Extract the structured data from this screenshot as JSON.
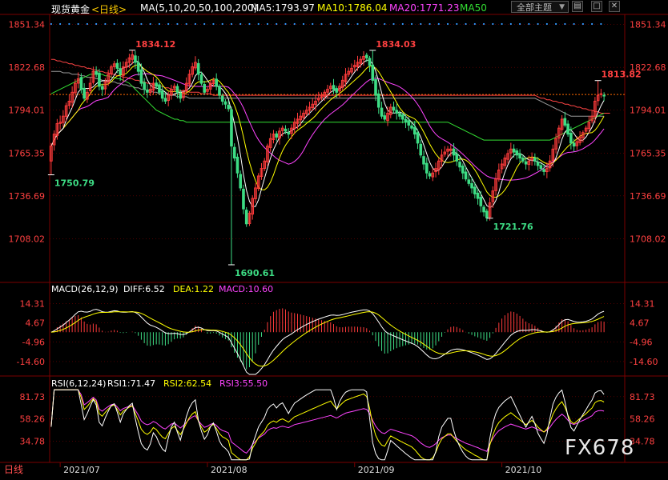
{
  "toolbar": {
    "symbol": "现货黄金",
    "period": "<日线>",
    "ma_params": "MA(5,10,20,50,100,200)",
    "ma5": "MA5:1793.97",
    "ma10": "MA10:1786.04",
    "ma20": "MA20:1771.23",
    "ma50": "MA50",
    "theme_button": "全部主题",
    "icons": [
      "dropdown-arrow-icon",
      "panel-toggle-icon",
      "maximize-icon",
      "close-icon"
    ]
  },
  "colors": {
    "up": "#ff3b3b",
    "down": "#3ddc84",
    "ma5": "#ffffff",
    "ma10": "#ffff00",
    "ma20": "#ff44ff",
    "ma50": "#33dd33",
    "ma100": "#999999",
    "ma200": "#ff4444",
    "axis_text": "#ff4040",
    "grid": "#7a0000"
  },
  "macd_panel": {
    "title": "MACD(26,12,9)",
    "diff": "DIFF:6.52",
    "dea": "DEA:1.22",
    "macd": "MACD:10.60"
  },
  "rsi_panel": {
    "title": "RSI(6,12,24)",
    "rsi1": "RSI1:71.47",
    "rsi2": "RSI2:62.54",
    "rsi3": "RSI3:55.50"
  },
  "watermark": "FX678",
  "period_tag": "日线",
  "chart_data": {
    "type": "candlestick",
    "y_ticks": [
      "1851.34",
      "1822.68",
      "1794.01",
      "1765.35",
      "1736.69",
      "1708.02"
    ],
    "y_tick_values": [
      1851.34,
      1822.68,
      1794.01,
      1765.35,
      1736.69,
      1708.02
    ],
    "ylim": [
      1679.36,
      1857
    ],
    "macd_ticks": [
      "14.31",
      "4.67",
      "-4.96",
      "-14.60"
    ],
    "macd_tick_values": [
      14.31,
      4.67,
      -4.96,
      -14.6
    ],
    "macd_ylim": [
      -21,
      18
    ],
    "rsi_ticks": [
      "81.73",
      "58.26",
      "34.78"
    ],
    "rsi_tick_values": [
      81.73,
      58.26,
      34.78
    ],
    "rsi_ylim": [
      14,
      90
    ],
    "x_labels": [
      "2021/07",
      "2021/08",
      "2021/09",
      "2021/10"
    ],
    "x_label_index": [
      3,
      52,
      101,
      150
    ],
    "current_price": 1804.5,
    "annotations": [
      {
        "text": "1834.12",
        "index": 27,
        "price": 1834.12,
        "kind": "high"
      },
      {
        "text": "1750.79",
        "index": 0,
        "price": 1750.79,
        "kind": "low"
      },
      {
        "text": "1690.61",
        "index": 60,
        "price": 1690.61,
        "kind": "low"
      },
      {
        "text": "1834.03",
        "index": 107,
        "price": 1834.03,
        "kind": "high"
      },
      {
        "text": "1721.76",
        "index": 146,
        "price": 1721.76,
        "kind": "low"
      },
      {
        "text": "1813.82",
        "index": 182,
        "price": 1813.82,
        "kind": "high"
      }
    ],
    "close": [
      1770,
      1778,
      1785,
      1786,
      1790,
      1797,
      1800,
      1806,
      1812,
      1815,
      1808,
      1802,
      1806,
      1812,
      1820,
      1818,
      1810,
      1808,
      1813,
      1818,
      1823,
      1825,
      1822,
      1818,
      1823,
      1826,
      1829,
      1831,
      1826,
      1820,
      1812,
      1808,
      1806,
      1808,
      1812,
      1810,
      1806,
      1802,
      1800,
      1804,
      1808,
      1810,
      1806,
      1802,
      1806,
      1812,
      1818,
      1823,
      1826,
      1818,
      1812,
      1806,
      1808,
      1812,
      1814,
      1810,
      1804,
      1800,
      1798,
      1795,
      1770,
      1762,
      1752,
      1742,
      1728,
      1718,
      1725,
      1735,
      1742,
      1750,
      1755,
      1760,
      1770,
      1775,
      1778,
      1776,
      1780,
      1782,
      1780,
      1778,
      1782,
      1786,
      1788,
      1790,
      1792,
      1794,
      1796,
      1798,
      1800,
      1802,
      1804,
      1806,
      1808,
      1810,
      1808,
      1806,
      1810,
      1814,
      1818,
      1820,
      1822,
      1824,
      1826,
      1828,
      1830,
      1829,
      1824,
      1814,
      1804,
      1796,
      1790,
      1788,
      1792,
      1796,
      1794,
      1792,
      1790,
      1788,
      1786,
      1784,
      1782,
      1778,
      1772,
      1764,
      1758,
      1752,
      1750,
      1752,
      1755,
      1760,
      1764,
      1766,
      1768,
      1768,
      1764,
      1760,
      1756,
      1752,
      1748,
      1745,
      1742,
      1738,
      1735,
      1730,
      1726,
      1722,
      1732,
      1740,
      1748,
      1754,
      1758,
      1762,
      1765,
      1768,
      1766,
      1764,
      1762,
      1760,
      1758,
      1760,
      1762,
      1760,
      1757,
      1755,
      1753,
      1755,
      1760,
      1768,
      1775,
      1782,
      1788,
      1784,
      1778,
      1772,
      1770,
      1773,
      1776,
      1779,
      1782,
      1786,
      1790,
      1800,
      1804,
      1805,
      1804
    ],
    "ma50": [
      1805,
      1806,
      1807,
      1808,
      1809,
      1810,
      1811,
      1812,
      1813,
      1814,
      1815,
      1816,
      1817,
      1818,
      1818,
      1818,
      1818,
      1818,
      1817,
      1817,
      1816,
      1816,
      1815,
      1815,
      1814,
      1813,
      1812,
      1810,
      1808,
      1806,
      1804,
      1802,
      1800,
      1798,
      1796,
      1794,
      1793,
      1792,
      1791,
      1790,
      1789,
      1788,
      1788,
      1787,
      1787,
      1786,
      1786,
      1786,
      1786,
      1786,
      1786,
      1786,
      1786,
      1786,
      1786,
      1786,
      1786,
      1786,
      1786,
      1786,
      1786,
      1786,
      1786,
      1786,
      1786,
      1786,
      1786,
      1786,
      1786,
      1786,
      1786,
      1786,
      1786,
      1786,
      1786,
      1786,
      1786,
      1786,
      1786,
      1786,
      1786,
      1786,
      1786,
      1786,
      1786,
      1786,
      1786,
      1786,
      1786,
      1786,
      1786,
      1786,
      1786,
      1786,
      1786,
      1786,
      1786,
      1786,
      1786,
      1786,
      1786,
      1786,
      1786,
      1786,
      1786,
      1786,
      1786,
      1786,
      1786,
      1786,
      1786,
      1786,
      1786,
      1786,
      1786,
      1786,
      1786,
      1786,
      1786,
      1786,
      1786,
      1786,
      1786,
      1786,
      1786,
      1786,
      1786,
      1786,
      1786,
      1786,
      1786,
      1786,
      1786,
      1785,
      1784,
      1783,
      1782,
      1781,
      1780,
      1779,
      1778,
      1777,
      1776,
      1775,
      1774,
      1774,
      1774,
      1774,
      1774,
      1774,
      1774,
      1774,
      1774,
      1774,
      1774,
      1774,
      1774,
      1774,
      1774,
      1774,
      1774,
      1774,
      1774,
      1774,
      1774,
      1774,
      1774,
      1775,
      1776,
      1777,
      1778,
      1779,
      1780,
      1781,
      1782,
      1783,
      1784,
      1785,
      1786,
      1787,
      1788,
      1789,
      1790,
      1791,
      1792
    ],
    "ma100": [
      1820,
      1820,
      1820,
      1820,
      1819,
      1819,
      1819,
      1818,
      1818,
      1818,
      1817,
      1817,
      1816,
      1816,
      1816,
      1815,
      1815,
      1814,
      1814,
      1814,
      1813,
      1813,
      1812,
      1812,
      1811,
      1811,
      1810,
      1810,
      1809,
      1809,
      1808,
      1808,
      1807,
      1807,
      1806,
      1806,
      1805,
      1805,
      1805,
      1804,
      1804,
      1804,
      1803,
      1803,
      1803,
      1803,
      1802,
      1802,
      1802,
      1802,
      1802,
      1802,
      1802,
      1802,
      1802,
      1802,
      1802,
      1802,
      1802,
      1802,
      1802,
      1802,
      1802,
      1802,
      1802,
      1802,
      1802,
      1802,
      1802,
      1802,
      1802,
      1802,
      1802,
      1802,
      1802,
      1802,
      1802,
      1802,
      1802,
      1802,
      1802,
      1802,
      1802,
      1802,
      1802,
      1802,
      1802,
      1802,
      1802,
      1802,
      1802,
      1802,
      1802,
      1802,
      1802,
      1802,
      1802,
      1802,
      1802,
      1802,
      1802,
      1802,
      1802,
      1802,
      1802,
      1802,
      1802,
      1802,
      1802,
      1802,
      1802,
      1802,
      1802,
      1802,
      1802,
      1802,
      1802,
      1802,
      1802,
      1802,
      1802,
      1802,
      1802,
      1802,
      1802,
      1802,
      1802,
      1802,
      1802,
      1802,
      1802,
      1802,
      1802,
      1802,
      1802,
      1802,
      1802,
      1802,
      1802,
      1802,
      1802,
      1802,
      1802,
      1802,
      1802,
      1802,
      1802,
      1802,
      1802,
      1802,
      1802,
      1802,
      1802,
      1802,
      1802,
      1802,
      1802,
      1802,
      1802,
      1802,
      1802,
      1802,
      1801,
      1800,
      1799,
      1798,
      1797,
      1796,
      1795,
      1794,
      1793,
      1792,
      1791,
      1790,
      1790,
      1790,
      1790,
      1790,
      1790,
      1790,
      1790,
      1790,
      1790,
      1790,
      1790
    ],
    "ma200": [
      1828,
      1828,
      1827,
      1827,
      1826,
      1826,
      1825,
      1825,
      1824,
      1824,
      1823,
      1823,
      1822,
      1822,
      1821,
      1821,
      1820,
      1820,
      1819,
      1819,
      1818,
      1818,
      1817,
      1817,
      1816,
      1816,
      1815,
      1815,
      1814,
      1814,
      1813,
      1813,
      1812,
      1812,
      1811,
      1811,
      1810,
      1810,
      1809,
      1809,
      1808,
      1808,
      1808,
      1807,
      1807,
      1807,
      1806,
      1806,
      1806,
      1806,
      1805,
      1805,
      1805,
      1805,
      1804,
      1804,
      1804,
      1804,
      1804,
      1804,
      1804,
      1804,
      1804,
      1804,
      1804,
      1804,
      1804,
      1804,
      1804,
      1804,
      1804,
      1804,
      1804,
      1804,
      1804,
      1804,
      1804,
      1804,
      1804,
      1804,
      1804,
      1804,
      1804,
      1804,
      1804,
      1804,
      1804,
      1804,
      1804,
      1804,
      1804,
      1804,
      1804,
      1804,
      1804,
      1804,
      1804,
      1804,
      1804,
      1804,
      1804,
      1804,
      1804,
      1804,
      1804,
      1804,
      1804,
      1804,
      1804,
      1804,
      1804,
      1804,
      1804,
      1804,
      1804,
      1804,
      1804,
      1804,
      1804,
      1804,
      1804,
      1804,
      1804,
      1804,
      1804,
      1804,
      1804,
      1804,
      1804,
      1804,
      1804,
      1804,
      1804,
      1804,
      1804,
      1804,
      1804,
      1804,
      1804,
      1804,
      1804,
      1804,
      1804,
      1804,
      1804,
      1804,
      1804,
      1804,
      1804,
      1804,
      1804,
      1804,
      1804,
      1804,
      1804,
      1804,
      1804,
      1804,
      1804,
      1804,
      1804,
      1804,
      1803,
      1802,
      1802,
      1801,
      1801,
      1800,
      1800,
      1799,
      1799,
      1798,
      1798,
      1797,
      1797,
      1796,
      1796,
      1795,
      1795,
      1794,
      1794,
      1793,
      1793,
      1792,
      1792,
      1792,
      1792
    ]
  }
}
